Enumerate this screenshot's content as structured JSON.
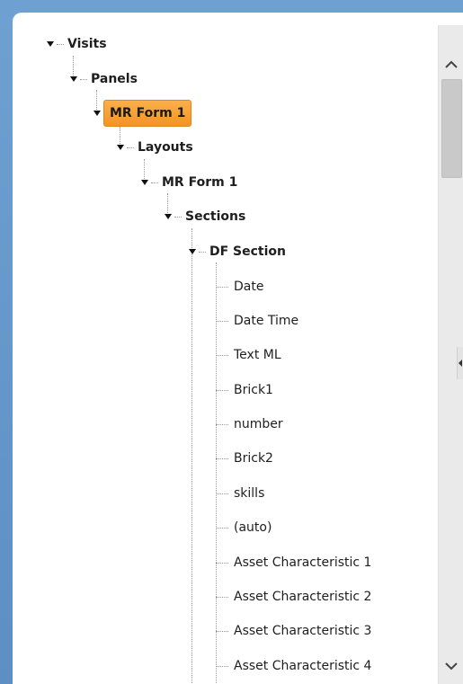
{
  "tree": {
    "visits": "Visits",
    "panels": "Panels",
    "mr_form_selected": "MR Form 1",
    "layouts": "Layouts",
    "mr_form_layout": "MR Form 1",
    "sections": "Sections",
    "df_section": "DF Section",
    "fields": [
      "Date",
      "Date Time",
      "Text ML",
      "Brick1",
      "number",
      "Brick2",
      "skills",
      "(auto)",
      "Asset Characteristic 1",
      "Asset Characteristic 2",
      "Asset Characteristic 3",
      "Asset Characteristic 4"
    ]
  },
  "scrollbar": {
    "up_icon": "chevron-up-icon",
    "down_icon": "chevron-down-icon",
    "position_fraction": 0.05
  },
  "colors": {
    "selection": "#f39423",
    "frame": "#5f93c8"
  }
}
